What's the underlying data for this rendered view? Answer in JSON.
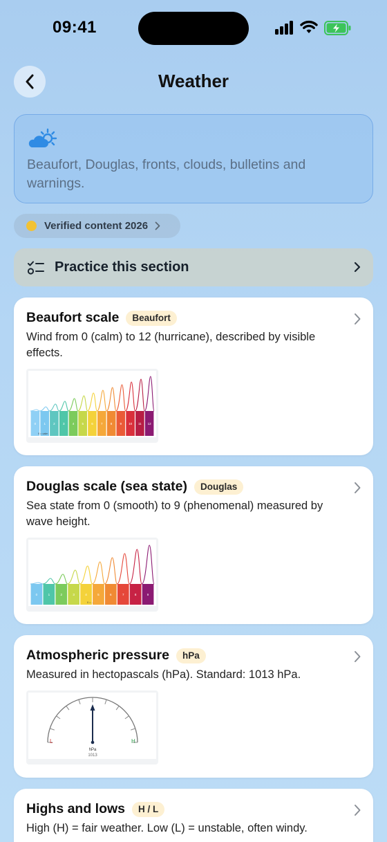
{
  "status_bar": {
    "time": "09:41"
  },
  "header": {
    "title": "Weather"
  },
  "description": {
    "text": "Beaufort, Douglas, fronts, clouds, bulletins and warnings."
  },
  "verified": {
    "label": "Verified content 2026"
  },
  "practice": {
    "label": "Practice this section"
  },
  "cards": [
    {
      "title": "Beaufort scale",
      "badge": "Beaufort",
      "description": "Wind from 0 (calm) to 12 (hurricane), described by visible effects.",
      "scale": {
        "levels": [
          "0",
          "1",
          "2",
          "3",
          "4",
          "5",
          "6",
          "7",
          "8",
          "9",
          "10",
          "11",
          "12"
        ],
        "caption": "0 = calm",
        "colors": [
          "#8fd0f5",
          "#7cc8f0",
          "#5fc6c0",
          "#4fc6a8",
          "#7ccb5c",
          "#c6d84a",
          "#f4d23a",
          "#f5a83a",
          "#f08a33",
          "#ea5a36",
          "#d92f3b",
          "#b71d44",
          "#8b1a72"
        ]
      }
    },
    {
      "title": "Douglas scale (sea state)",
      "badge": "Douglas",
      "description": "Sea state from 0 (smooth) to 9 (phenomenal) measured by wave height.",
      "scale": {
        "levels": [
          "0",
          "1",
          "2",
          "3",
          "4",
          "5",
          "6",
          "7",
          "8",
          "9"
        ],
        "caption": "0 = ...",
        "colors": [
          "#7cc8f0",
          "#4fc6a8",
          "#7ccb5c",
          "#c6d84a",
          "#f4d23a",
          "#f5a83a",
          "#f08a33",
          "#e5473a",
          "#c72244",
          "#8b1a72"
        ]
      }
    },
    {
      "title": "Atmospheric pressure",
      "badge": "hPa",
      "description": "Measured in hectopascals (hPa). Standard: 1013 hPa.",
      "gauge": {
        "unit": "hPa",
        "value": "1013",
        "low": "L",
        "high": "H"
      }
    },
    {
      "title": "Highs and lows",
      "badge": "H / L",
      "description": "High (H) = fair weather. Low (L) = unstable, often windy."
    }
  ]
}
